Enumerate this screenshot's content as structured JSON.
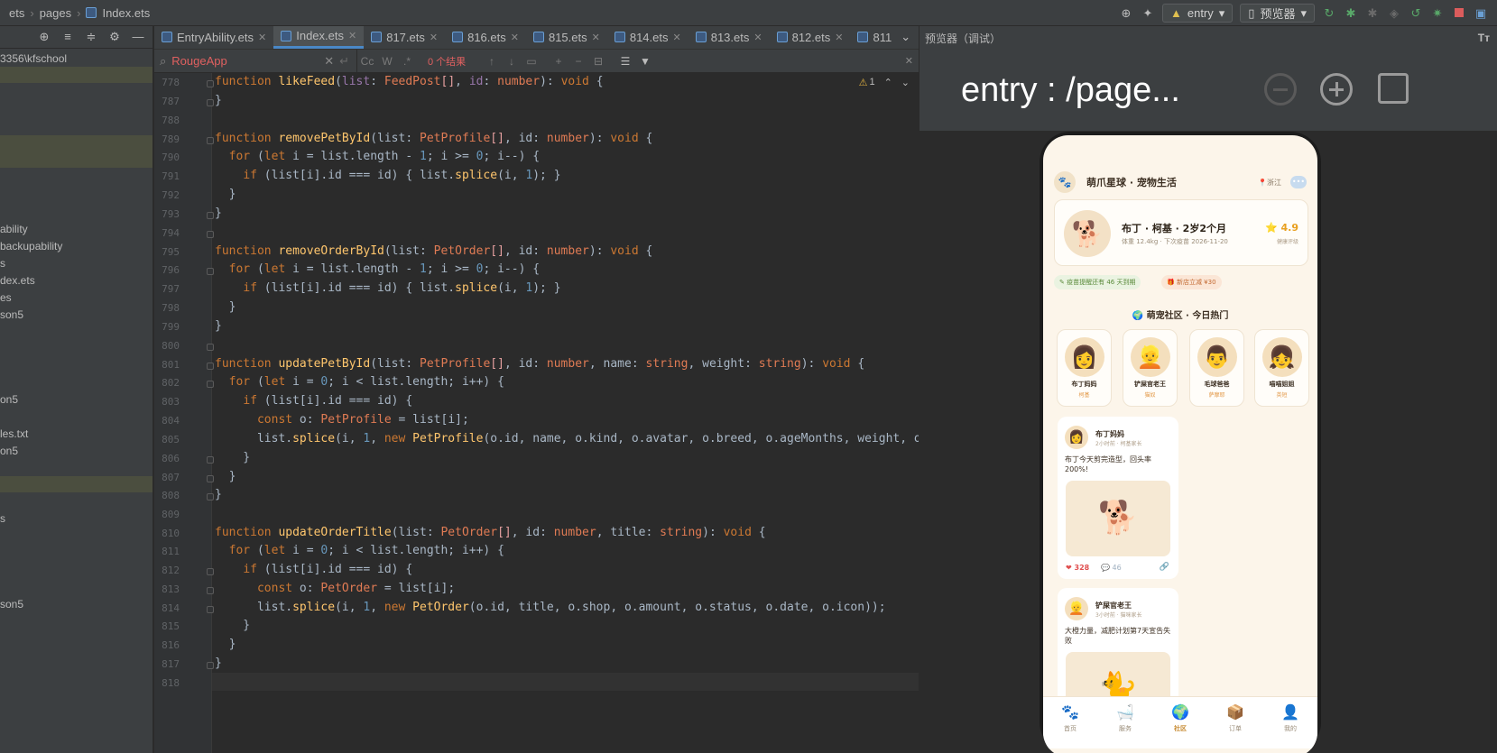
{
  "breadcrumb": {
    "items": [
      "ets",
      "pages",
      "Index.ets"
    ]
  },
  "topbar": {
    "module": "entry",
    "device": "预览器"
  },
  "left_panel": {
    "path": "3356\\kfschool",
    "items": [
      "ability",
      "backupability",
      "s",
      "dex.ets",
      "es",
      "son5",
      "on5",
      "les.txt",
      "on5",
      "s",
      "son5"
    ]
  },
  "tabs": [
    {
      "label": "EntryAbility.ets",
      "active": false
    },
    {
      "label": "Index.ets",
      "active": true
    },
    {
      "label": "817.ets",
      "active": false
    },
    {
      "label": "816.ets",
      "active": false
    },
    {
      "label": "815.ets",
      "active": false
    },
    {
      "label": "814.ets",
      "active": false
    },
    {
      "label": "813.ets",
      "active": false
    },
    {
      "label": "812.ets",
      "active": false
    },
    {
      "label": "811",
      "active": false
    }
  ],
  "search": {
    "value": "RougeApp",
    "results": "0 个结果"
  },
  "editor": {
    "warnings": "1",
    "line_numbers": [
      "778",
      "787",
      "788",
      "789",
      "790",
      "791",
      "792",
      "793",
      "794",
      "795",
      "796",
      "797",
      "798",
      "799",
      "800",
      "801",
      "802",
      "803",
      "804",
      "805",
      "806",
      "807",
      "808",
      "809",
      "810",
      "811",
      "812",
      "813",
      "814",
      "815",
      "816",
      "817",
      "818"
    ]
  },
  "preview": {
    "title": "预览器（调试）",
    "route": "entry : /page...",
    "app": {
      "title": "萌爪星球 · 宠物生活",
      "location": "浙江",
      "pet": {
        "name": "布丁 · 柯基 · 2岁2个月",
        "sub": "体重 12.4kg · 下次疫苗 2026-11-20",
        "score": "4.9",
        "score_label": "健康评级"
      },
      "chips": [
        "疫苗提醒还有 46 天到期",
        "新店立减 ¥30"
      ],
      "section_title": "萌宠社区 · 今日热门",
      "users": [
        {
          "name": "布丁妈妈",
          "tag": "柯基",
          "emoji": "👩"
        },
        {
          "name": "铲屎官老王",
          "tag": "猫奴",
          "emoji": "👱"
        },
        {
          "name": "毛球爸爸",
          "tag": "萨摩耶",
          "emoji": "👨"
        },
        {
          "name": "喵喵姐姐",
          "tag": "英短",
          "emoji": "👧"
        }
      ],
      "posts": [
        {
          "author": "布丁妈妈",
          "time": "2小时前 · 柯基家长",
          "content": "布丁今天剪完造型，回头率200%!",
          "likes": "328",
          "comments": "46",
          "emoji": "🐕"
        },
        {
          "author": "铲屎官老王",
          "time": "3小时前 · 猫咪家长",
          "content": "大橙力量，减肥计划第7天宣告失败",
          "emoji": "🐈"
        }
      ],
      "nav": [
        {
          "label": "首页",
          "icon": "🐾",
          "active": false
        },
        {
          "label": "服务",
          "icon": "🛁",
          "active": false
        },
        {
          "label": "社区",
          "icon": "🌍",
          "active": true
        },
        {
          "label": "订单",
          "icon": "📦",
          "active": false
        },
        {
          "label": "我的",
          "icon": "👤",
          "active": false
        }
      ]
    }
  }
}
